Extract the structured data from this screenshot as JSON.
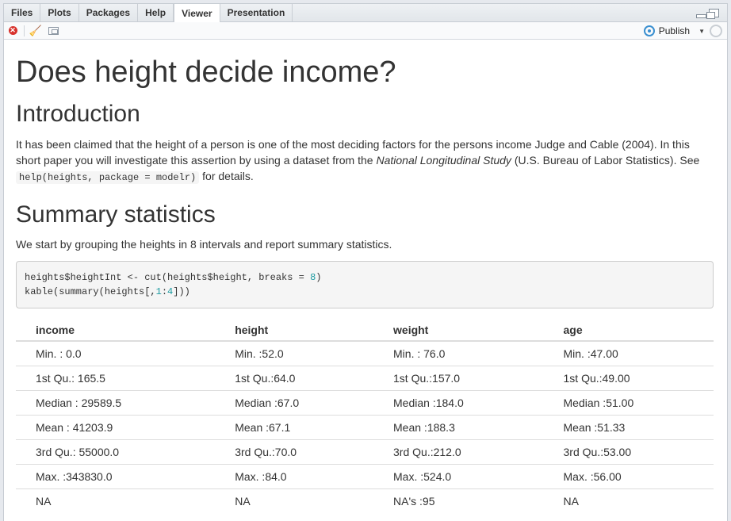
{
  "tabs": [
    "Files",
    "Plots",
    "Packages",
    "Help",
    "Viewer",
    "Presentation"
  ],
  "active_tab": "Viewer",
  "toolbar": {
    "publish_label": "Publish"
  },
  "doc": {
    "title": "Does height decide income?",
    "intro_heading": "Introduction",
    "intro_text_1": "It has been claimed that the height of a person is one of the most deciding factors for the persons income Judge and Cable (2004). In this short paper you will investigate this assertion by using a dataset from the ",
    "intro_italic": "National Longitudinal Study",
    "intro_text_2": " (U.S. Bureau of Labor Statistics). See ",
    "intro_code": "help(heights, package = modelr)",
    "intro_text_3": " for details.",
    "summary_heading": "Summary statistics",
    "summary_text": "We start by grouping the heights in 8 intervals and report summary statistics.",
    "code_line1_a": "heights$heightInt <- cut(heights$height, breaks = ",
    "code_line1_num": "8",
    "code_line1_b": ")",
    "code_line2_a": "kable(summary(heights[,",
    "code_line2_n1": "1",
    "code_line2_colon": ":",
    "code_line2_n2": "4",
    "code_line2_b": "]))"
  },
  "table": {
    "headers": [
      "income",
      "height",
      "weight",
      "age"
    ],
    "rows": [
      [
        "Min. : 0.0",
        "Min. :52.0",
        "Min. : 76.0",
        "Min. :47.00"
      ],
      [
        "1st Qu.: 165.5",
        "1st Qu.:64.0",
        "1st Qu.:157.0",
        "1st Qu.:49.00"
      ],
      [
        "Median : 29589.5",
        "Median :67.0",
        "Median :184.0",
        "Median :51.00"
      ],
      [
        "Mean : 41203.9",
        "Mean :67.1",
        "Mean :188.3",
        "Mean :51.33"
      ],
      [
        "3rd Qu.: 55000.0",
        "3rd Qu.:70.0",
        "3rd Qu.:212.0",
        "3rd Qu.:53.00"
      ],
      [
        "Max. :343830.0",
        "Max. :84.0",
        "Max. :524.0",
        "Max. :56.00"
      ],
      [
        "NA",
        "NA",
        "NA's :95",
        "NA"
      ]
    ]
  }
}
